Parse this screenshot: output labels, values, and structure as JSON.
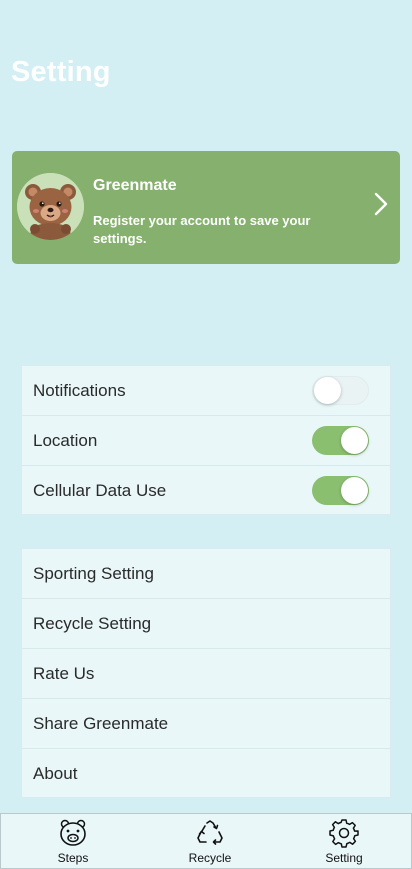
{
  "page": {
    "title": "Setting"
  },
  "profile": {
    "name": "Greenmate",
    "description": "Register your account to save your settings.",
    "avatar_icon": "bear-avatar-icon",
    "chevron_icon": "chevron-right-icon"
  },
  "toggles": [
    {
      "label": "Notifications",
      "on": false
    },
    {
      "label": "Location",
      "on": true
    },
    {
      "label": "Cellular Data Use",
      "on": true
    }
  ],
  "menu": [
    {
      "label": "Sporting Setting"
    },
    {
      "label": "Recycle Setting"
    },
    {
      "label": "Rate Us"
    },
    {
      "label": "Share Greenmate"
    },
    {
      "label": "About"
    }
  ],
  "tabs": [
    {
      "label": "Steps",
      "icon": "pig-icon"
    },
    {
      "label": "Recycle",
      "icon": "recycle-icon"
    },
    {
      "label": "Setting",
      "icon": "gear-icon"
    }
  ],
  "colors": {
    "background": "#d3eff3",
    "card": "#86b06d",
    "toggle_on": "#8abf70",
    "toggle_off": "#eaf3f4",
    "list_bg": "#e9f7f9"
  }
}
